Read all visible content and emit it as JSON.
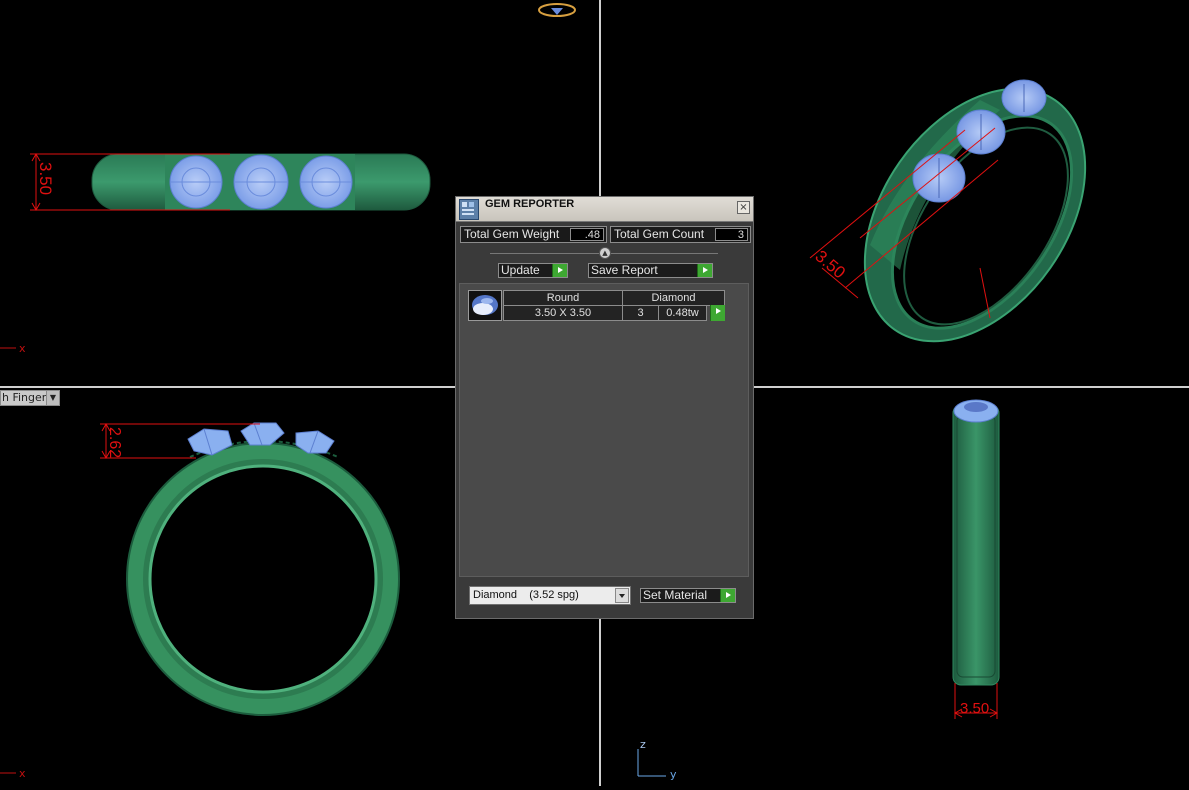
{
  "gem_reporter": {
    "title": "GEM REPORTER",
    "close_glyph": "×",
    "total_gem_weight_label": "Total Gem Weight",
    "total_gem_weight_value": ".48",
    "total_gem_count_label": "Total Gem Count",
    "total_gem_count_value": "3",
    "update_label": "Update",
    "save_report_label": "Save Report",
    "gem_list": {
      "header_shape": "Round",
      "header_material": "Diamond",
      "size": "3.50 X 3.50",
      "count": "3",
      "weight": "0.48tw"
    },
    "material_select_value": "Diamond    (3.52 spg)",
    "set_material_label": "Set Material"
  },
  "viewports": {
    "bottom_left_label": "h Finger",
    "axis_x_label": "x",
    "axis_y_label": "y",
    "axis_z_label": "z"
  },
  "dimensions": {
    "top_left_width": "3.50",
    "top_right_width": "3.50",
    "bottom_left_height": "2.62",
    "bottom_right_width": "3.50"
  },
  "colors": {
    "ring_green": "#2f8a5f",
    "gem_blue": "#8ab0f0",
    "dimension_red": "#e01010",
    "background": "#000000",
    "divider": "#cfcfcf",
    "play_green": "#3ea832"
  }
}
